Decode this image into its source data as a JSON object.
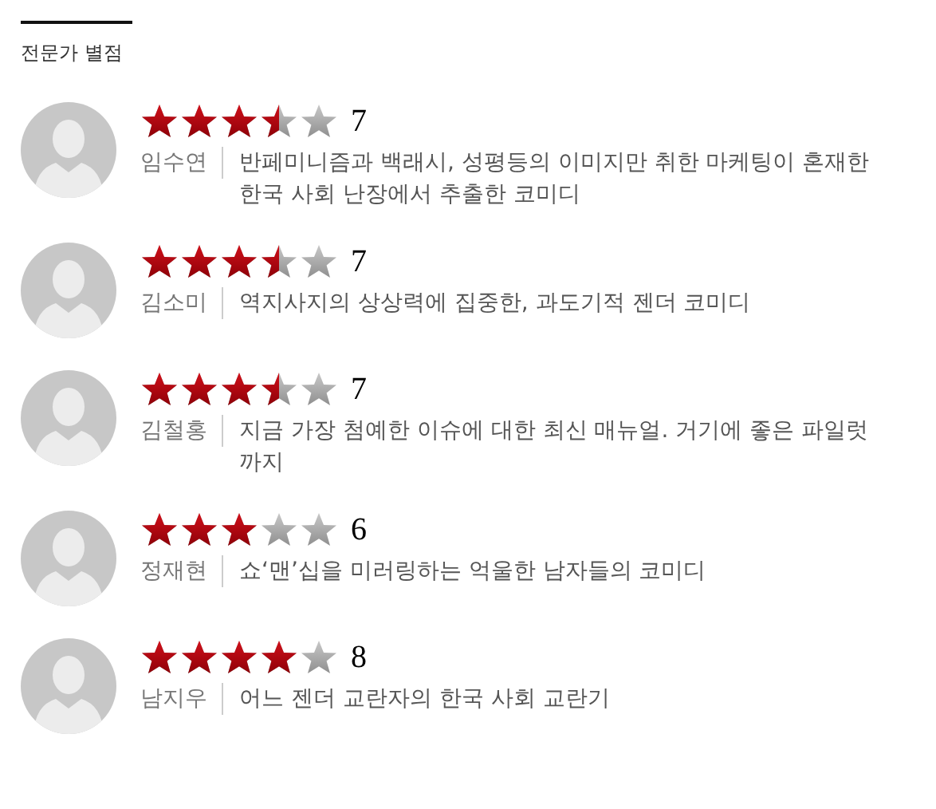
{
  "section_title": "전문가 별점",
  "reviews": [
    {
      "stars": 3.5,
      "score": "7",
      "name": "임수연",
      "comment": "반페미니즘과 백래시, 성평등의 이미지만 취한 마케팅이 혼재한 한국 사회 난장에서 추출한 코미디"
    },
    {
      "stars": 3.5,
      "score": "7",
      "name": "김소미",
      "comment": "역지사지의 상상력에 집중한, 과도기적 젠더 코미디"
    },
    {
      "stars": 3.5,
      "score": "7",
      "name": "김철홍",
      "comment": "지금 가장 첨예한 이슈에 대한 최신 매뉴얼. 거기에 좋은 파일럿까지"
    },
    {
      "stars": 3,
      "score": "6",
      "name": "정재현",
      "comment": "쇼‘맨’십을 미러링하는 억울한 남자들의 코미디"
    },
    {
      "stars": 4,
      "score": "8",
      "name": "남지우",
      "comment": "어느 젠더 교란자의 한국 사회 교란기"
    }
  ]
}
